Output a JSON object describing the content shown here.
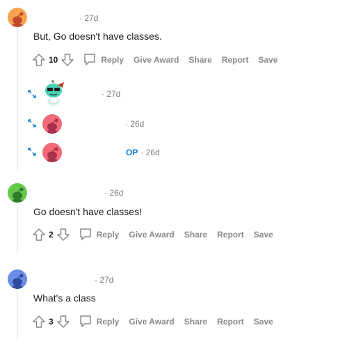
{
  "comment_1": {
    "time": "· 27d",
    "text": "But, Go doesn't have classes.",
    "votes": "10",
    "actions": {
      "reply": "Reply",
      "give_award": "Give Award",
      "share": "Share",
      "report": "Report",
      "save": "Save"
    },
    "collapsed_replies": [
      {
        "time": "· 27d",
        "op": ""
      },
      {
        "time": "· 26d",
        "op": ""
      },
      {
        "time": "· 26d",
        "op": "OP"
      }
    ]
  },
  "comment_2": {
    "time": "· 26d",
    "text": "Go doesn't have classes!",
    "votes": "2",
    "actions": {
      "reply": "Reply",
      "give_award": "Give Award",
      "share": "Share",
      "report": "Report",
      "save": "Save"
    }
  },
  "comment_3": {
    "time": "· 27d",
    "text": "What's a class",
    "votes": "3",
    "actions": {
      "reply": "Reply",
      "give_award": "Give Award",
      "share": "Share",
      "report": "Report",
      "save": "Save"
    }
  },
  "colors": {
    "avatar_orange": "#f6a34f",
    "avatar_pink": "#f06a7a",
    "avatar_green": "#64c94a",
    "avatar_blue": "#6b8de8",
    "avatar_teal": "#4bd1b4",
    "op_blue": "#0079d3",
    "action_gray": "#878a8c",
    "thread_line": "#edeff1"
  },
  "icons": {
    "upvote": "upvote-arrow-icon",
    "downvote": "downvote-arrow-icon",
    "reply": "speech-bubble-icon",
    "expand": "expand-arrows-icon"
  }
}
